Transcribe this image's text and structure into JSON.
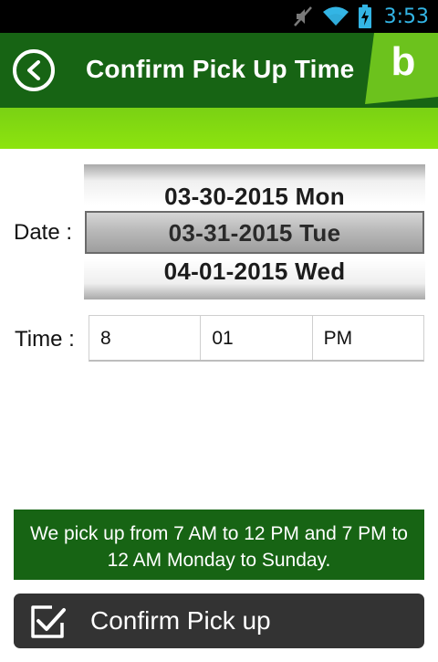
{
  "status_bar": {
    "time": "3:53",
    "icons": [
      "mute-icon",
      "wifi-icon",
      "battery-charging-icon"
    ],
    "time_color": "#33b5e5"
  },
  "app_bar": {
    "title": "Confirm Pick Up Time",
    "back_icon": "chevron-left-icon",
    "logo_letter": "b",
    "background": "#176414"
  },
  "accent_color": "#8de40e",
  "date": {
    "label": "Date :",
    "options": [
      "03-30-2015 Mon",
      "03-31-2015 Tue",
      "04-01-2015 Wed"
    ],
    "selected": "03-31-2015 Tue"
  },
  "time": {
    "label": "Time :",
    "hour": "8",
    "minute": "01",
    "ampm": "PM"
  },
  "info": {
    "text": "We pick up from 7 AM to 12 PM and 7 PM to 12 AM Monday to Sunday."
  },
  "confirm": {
    "label": "Confirm Pick up",
    "icon": "checkbox-checked-icon"
  }
}
